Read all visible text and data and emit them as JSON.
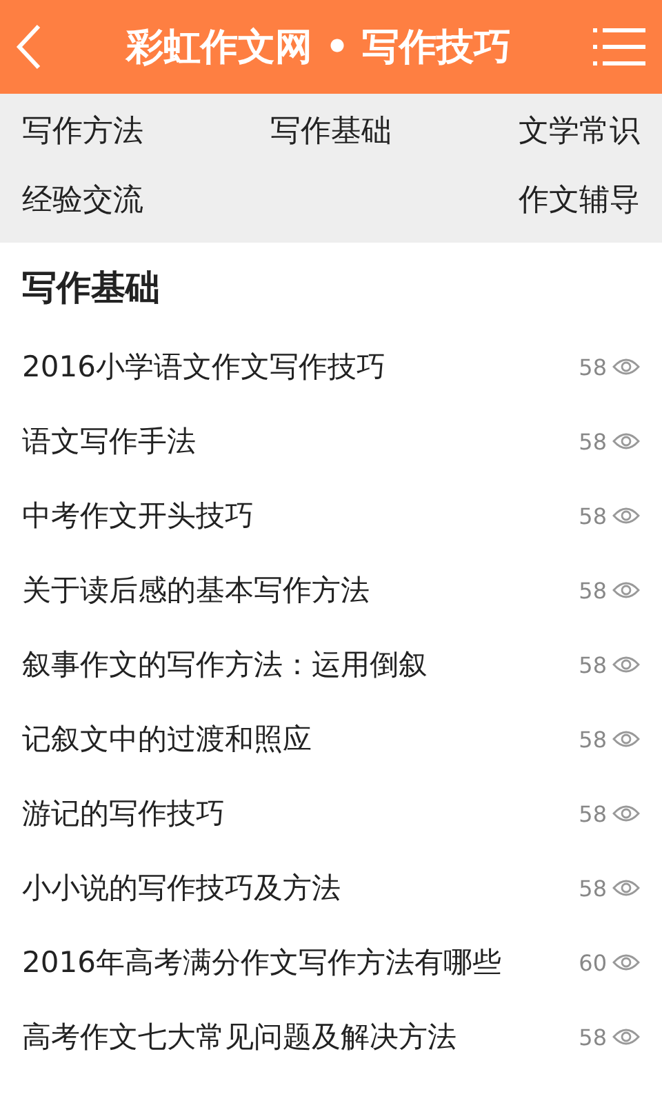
{
  "header": {
    "title": "彩虹作文网 • 写作技巧"
  },
  "categories": [
    [
      "写作方法",
      "写作基础",
      "文学常识"
    ],
    [
      "经验交流",
      "作文辅导"
    ]
  ],
  "section": {
    "title": "写作基础"
  },
  "articles": [
    {
      "title": "2016小学语文作文写作技巧",
      "views": "58"
    },
    {
      "title": "语文写作手法",
      "views": "58"
    },
    {
      "title": "中考作文开头技巧",
      "views": "58"
    },
    {
      "title": "关于读后感的基本写作方法",
      "views": "58"
    },
    {
      "title": "叙事作文的写作方法：运用倒叙",
      "views": "58"
    },
    {
      "title": "记叙文中的过渡和照应",
      "views": "58"
    },
    {
      "title": "游记的写作技巧",
      "views": "58"
    },
    {
      "title": "小小说的写作技巧及方法",
      "views": "58"
    },
    {
      "title": "2016年高考满分作文写作方法有哪些",
      "views": "60"
    },
    {
      "title": "高考作文七大常见问题及解决方法",
      "views": "58"
    }
  ]
}
